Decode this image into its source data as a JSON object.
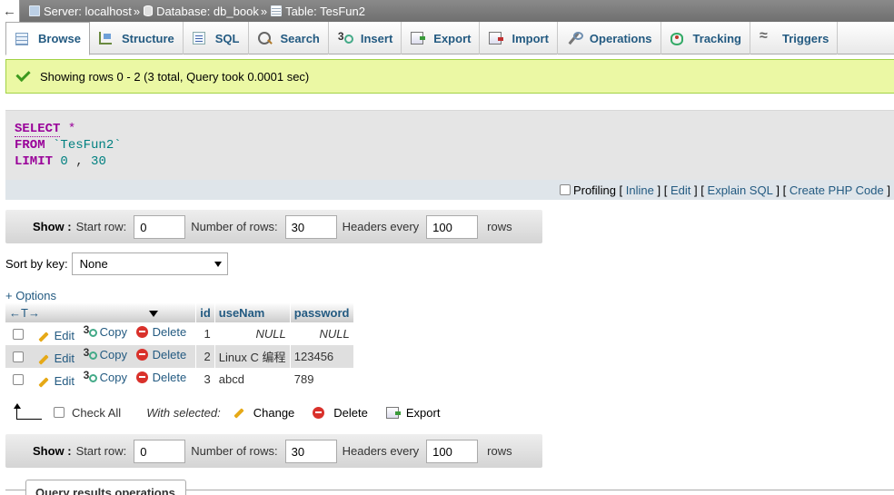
{
  "breadcrumb": {
    "back": "←",
    "server": "Server: localhost",
    "database": "Database: db_book",
    "table": "Table: TesFun2",
    "sep": "»"
  },
  "tabs": [
    {
      "label": "Browse"
    },
    {
      "label": "Structure"
    },
    {
      "label": "SQL"
    },
    {
      "label": "Search"
    },
    {
      "label": "Insert"
    },
    {
      "label": "Export"
    },
    {
      "label": "Import"
    },
    {
      "label": "Operations"
    },
    {
      "label": "Tracking"
    },
    {
      "label": "Triggers"
    }
  ],
  "message": "Showing rows 0 - 2 (3 total, Query took 0.0001 sec)",
  "sql": {
    "select": "SELECT",
    "star": "*",
    "from": "FROM",
    "table": "`TesFun2`",
    "limit": "LIMIT",
    "offset": "0",
    "comma": ",",
    "count": "30"
  },
  "sql_options": {
    "profiling": "Profiling",
    "inline": "Inline",
    "edit": "Edit",
    "explain": "Explain SQL",
    "php": "Create PHP Code",
    "open": "[",
    "close": "]"
  },
  "nav": {
    "show": "Show :",
    "start_row_label": "Start row:",
    "start_row": "0",
    "num_rows_label": "Number of rows:",
    "num_rows": "30",
    "headers_every_label": "Headers every",
    "headers_every": "100",
    "rows_label": "rows"
  },
  "sort": {
    "label": "Sort by key:",
    "value": "None"
  },
  "options_link": "+ Options",
  "table": {
    "arrows": "←T→",
    "columns": [
      "id",
      "useNam",
      "password"
    ],
    "actions": {
      "edit": "Edit",
      "copy": "Copy",
      "delete": "Delete"
    },
    "rows": [
      {
        "id": "1",
        "useNam": "NULL",
        "password": "NULL"
      },
      {
        "id": "2",
        "useNam": "Linux C 编程",
        "password": "123456"
      },
      {
        "id": "3",
        "useNam": "abcd",
        "password": "789"
      }
    ]
  },
  "bulk": {
    "check_all": "Check All",
    "with_selected": "With selected:",
    "change": "Change",
    "delete": "Delete",
    "export": "Export"
  },
  "query_results_operations": "Query results operations"
}
